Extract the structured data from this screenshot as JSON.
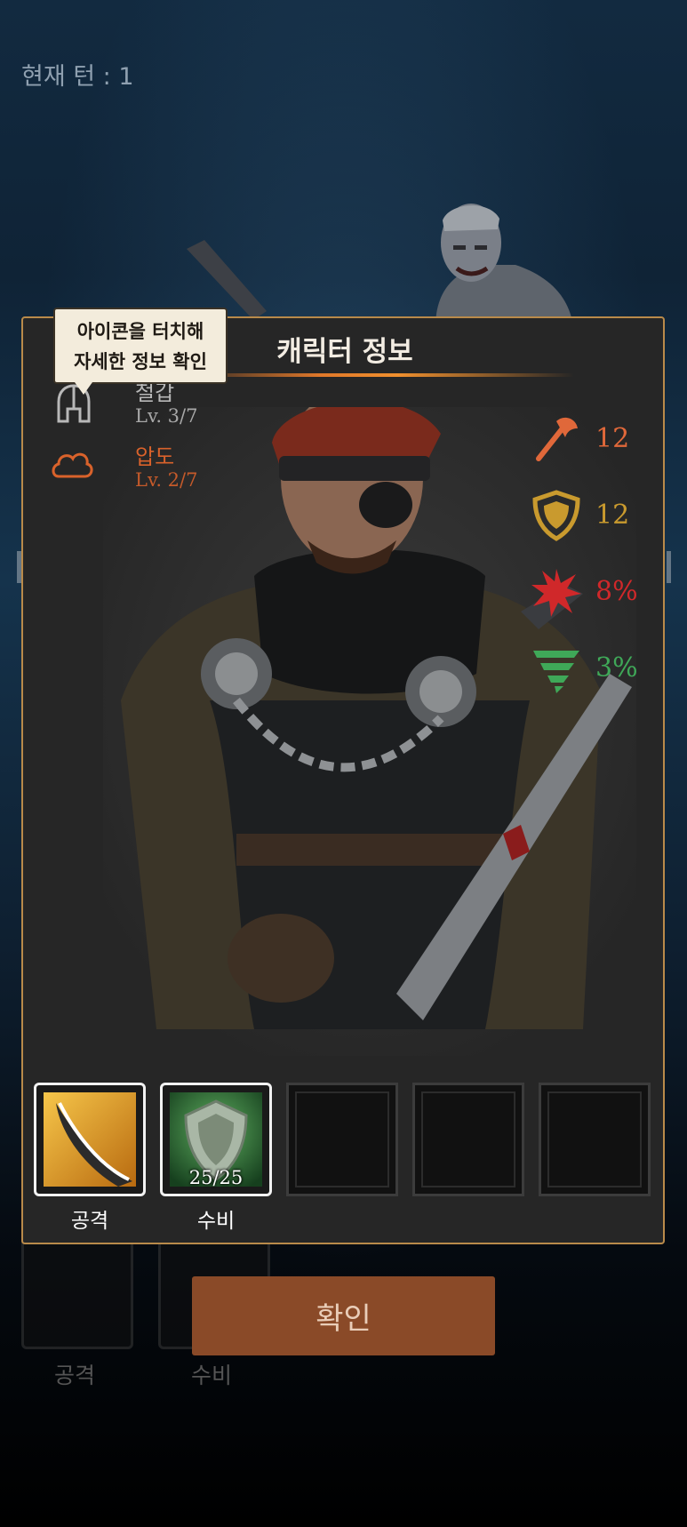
{
  "hud": {
    "turn_text": "현재 턴 : 1"
  },
  "panel": {
    "title": "캐릭터 정보",
    "tooltip_line1": "아이콘을 터치해",
    "tooltip_line2": "자세한 정보 확인"
  },
  "traits": [
    {
      "name": "철갑",
      "level": "Lv. 3/7",
      "icon": "helmet-icon",
      "color": "#b8b8b8"
    },
    {
      "name": "압도",
      "level": "Lv. 2/7",
      "icon": "cloud-icon",
      "color": "#d9622b"
    }
  ],
  "stats": [
    {
      "icon": "axe-icon",
      "value": "12",
      "color": "#e0683a"
    },
    {
      "icon": "shield-icon",
      "value": "12",
      "color": "#c99a2e"
    },
    {
      "icon": "burst-icon",
      "value": "8%",
      "color": "#d0282a"
    },
    {
      "icon": "tornado-icon",
      "value": "3%",
      "color": "#3fa858"
    }
  ],
  "skills": [
    {
      "label": "공격",
      "icon": "blade-icon",
      "count": ""
    },
    {
      "label": "수비",
      "icon": "shield-skill-icon",
      "count": "25/25"
    }
  ],
  "background_skills": [
    {
      "label": "공격"
    },
    {
      "label": "수비"
    }
  ],
  "confirm_label": "확인"
}
